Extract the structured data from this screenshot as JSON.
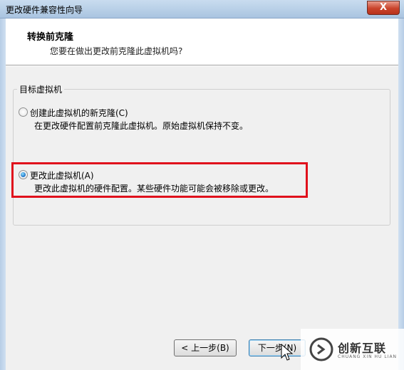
{
  "window": {
    "title": "更改硬件兼容性向导",
    "close_glyph": "X"
  },
  "header": {
    "title": "转换前克隆",
    "subtitle": "您要在做出更改前克隆此虚拟机吗?"
  },
  "group": {
    "label": "目标虚拟机",
    "options": [
      {
        "label": "创建此虚拟机的新克隆(C)",
        "description": "在更改硬件配置前克隆此虚拟机。原始虚拟机保持不变。",
        "selected": false
      },
      {
        "label": "更改此虚拟机(A)",
        "description": "更改此虚拟机的硬件配置。某些硬件功能可能会被移除或更改。",
        "selected": true
      }
    ]
  },
  "buttons": {
    "back": "< 上一步(B)",
    "next": "下一步(N)"
  },
  "watermark": {
    "name": "创新互联",
    "sub": "CHUANG XIN HU LIAN"
  },
  "colors": {
    "highlight": "#e0101c",
    "titlebar": "#a9c4e0",
    "close": "#c9432b"
  }
}
